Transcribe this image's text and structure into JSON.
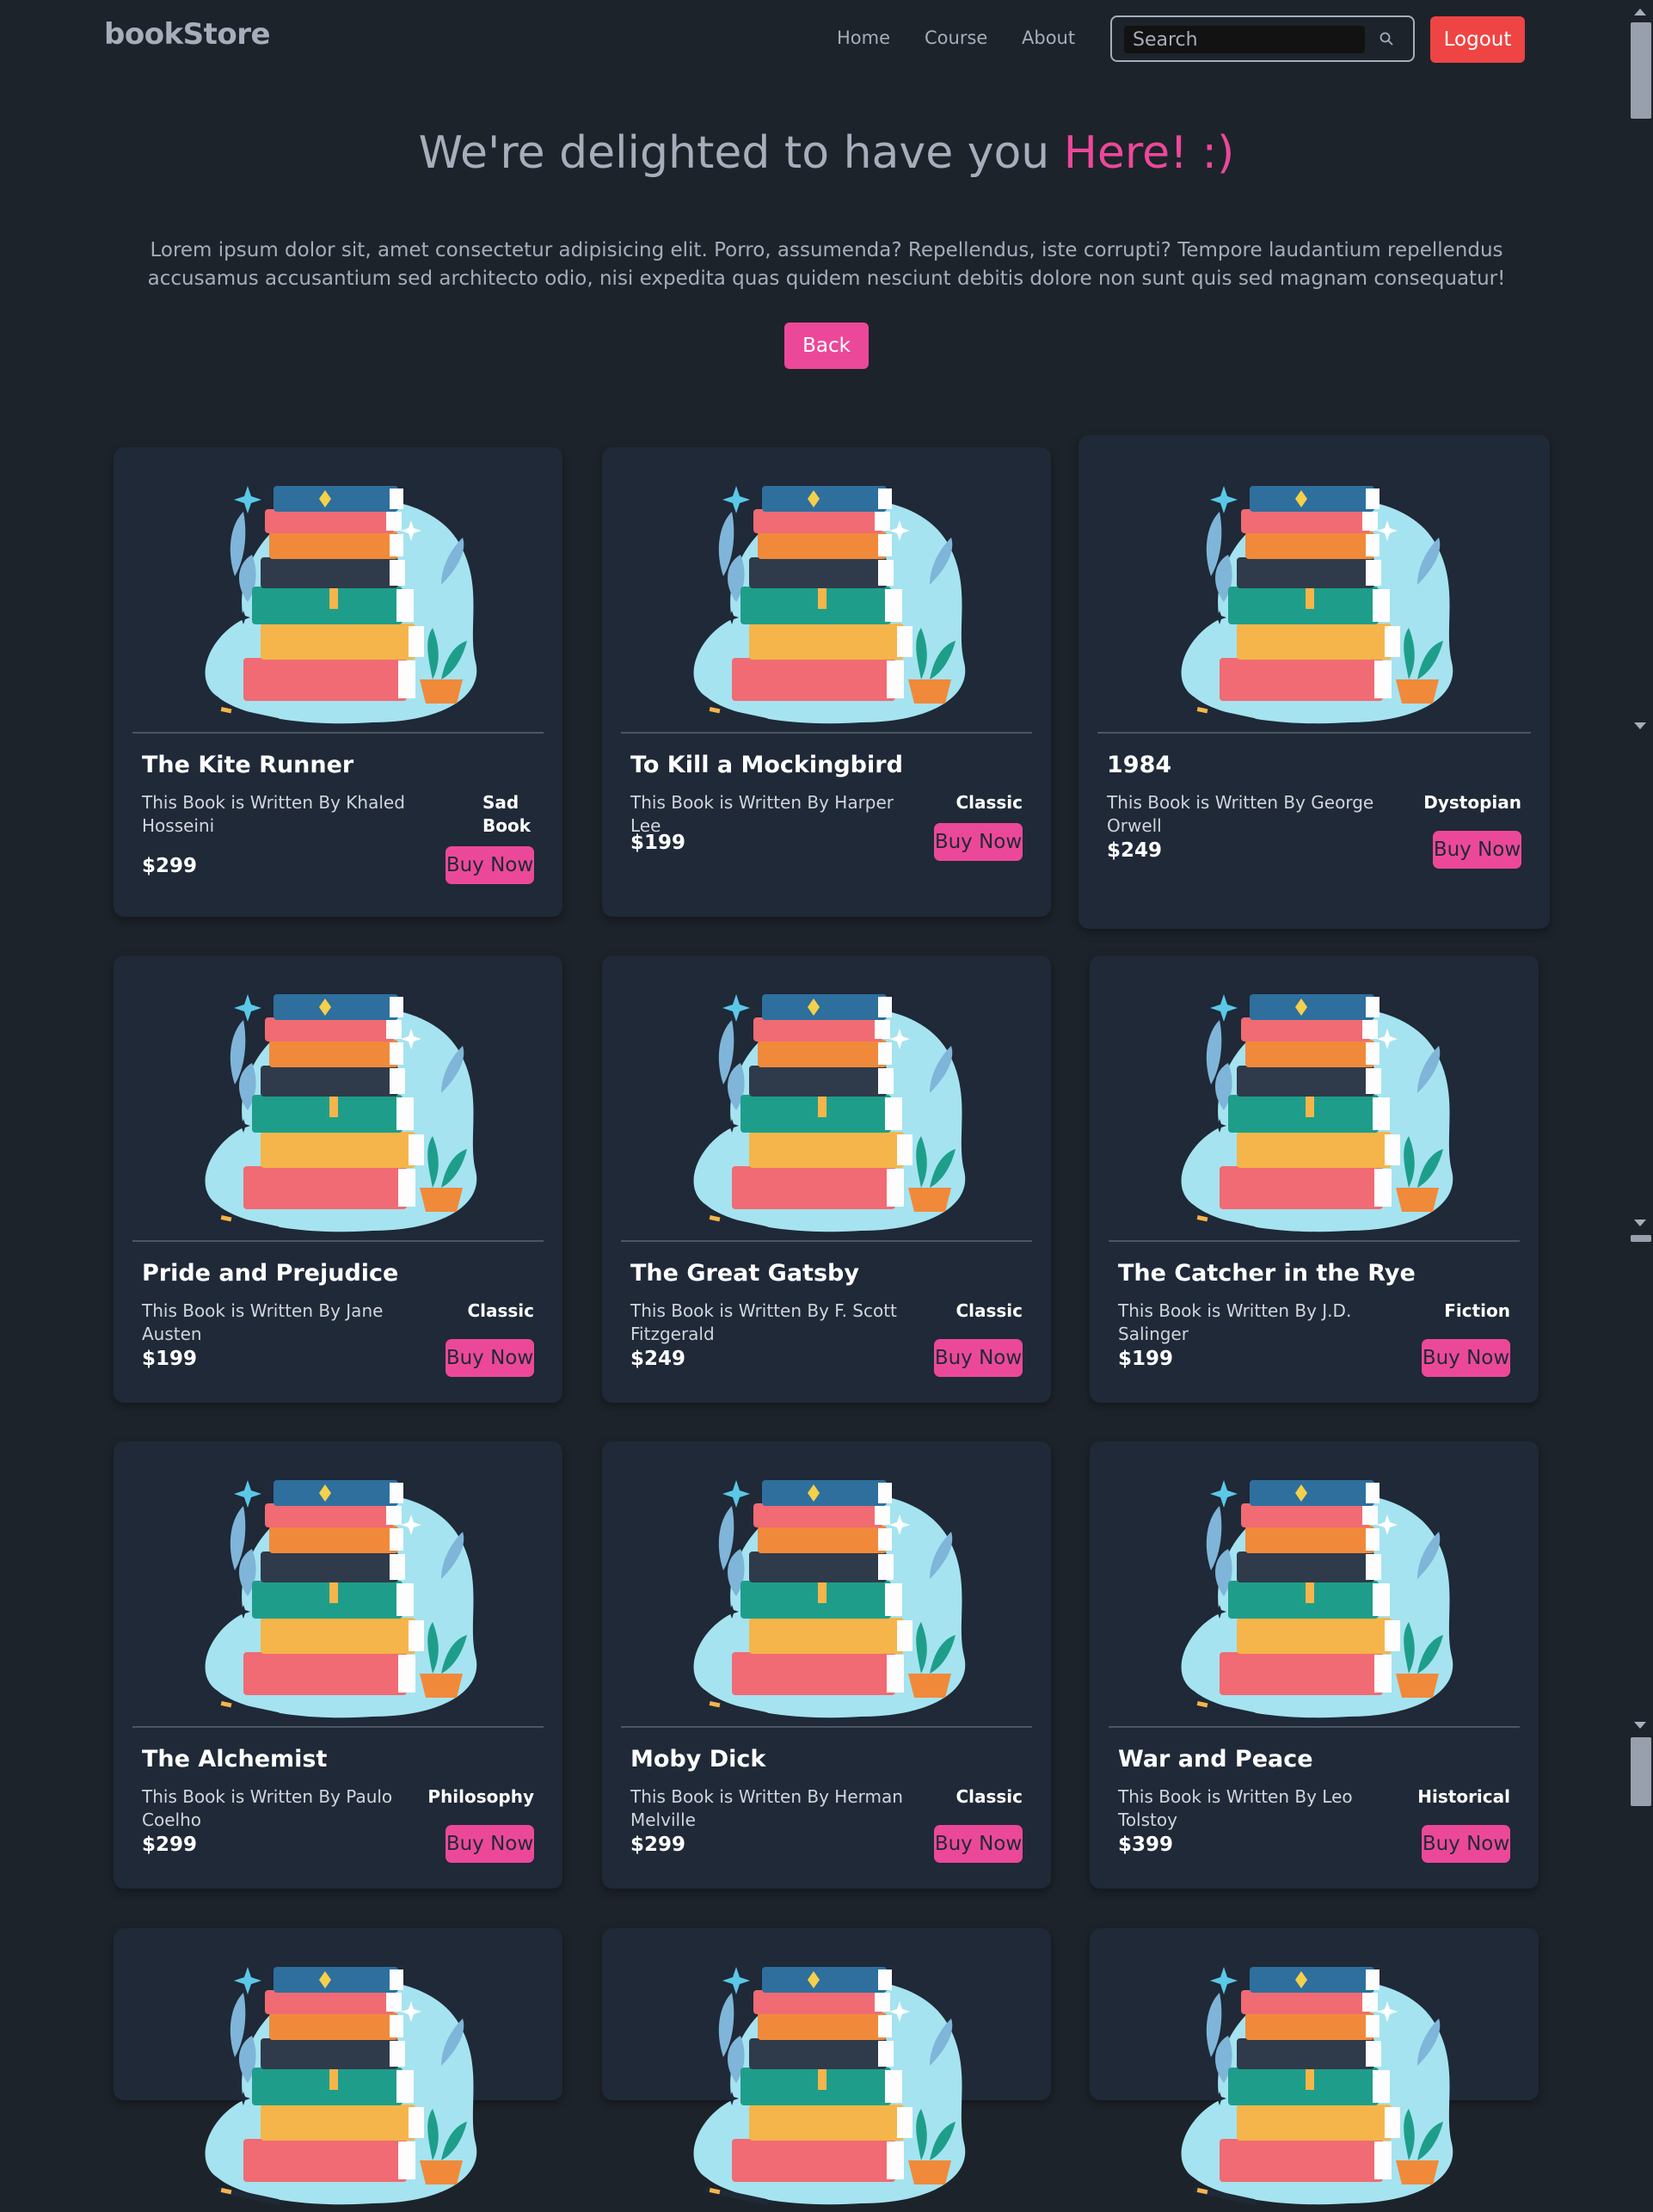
{
  "navbar": {
    "logo": "bookStore",
    "links": [
      "Home",
      "Course",
      "About"
    ],
    "search_placeholder": "Search",
    "logout_label": "Logout"
  },
  "hero": {
    "title_main": "We're delighted to have you ",
    "title_accent": "Here! :)",
    "text": "Lorem ipsum dolor sit, amet consectetur adipisicing elit. Porro, assumenda? Repellendus, iste corrupti? Tempore laudantium repellendus accusamus accusantium sed architecto odio, nisi expedita quas quidem nesciunt debitis dolore non sunt quis sed magnam consequatur!",
    "back_label": "Back"
  },
  "books": [
    {
      "title": "The Kite Runner",
      "author": "This Book is Written By Khaled Hosseini",
      "category": "Sad Book",
      "price": "$299",
      "buy_label": "Buy Now"
    },
    {
      "title": "To Kill a Mockingbird",
      "author": "This Book is Written By Harper Lee",
      "category": "Classic",
      "price": "$199",
      "buy_label": "Buy Now"
    },
    {
      "title": "1984",
      "author": "This Book is Written By George Orwell",
      "category": "Dystopian",
      "price": "$249",
      "buy_label": "Buy Now"
    },
    {
      "title": "Pride and Prejudice",
      "author": "This Book is Written By Jane Austen",
      "category": "Classic",
      "price": "$199",
      "buy_label": "Buy Now"
    },
    {
      "title": "The Great Gatsby",
      "author": "This Book is Written By F. Scott Fitzgerald",
      "category": "Classic",
      "price": "$249",
      "buy_label": "Buy Now"
    },
    {
      "title": "The Catcher in the Rye",
      "author": "This Book is Written By J.D. Salinger",
      "category": "Fiction",
      "price": "$199",
      "buy_label": "Buy Now"
    },
    {
      "title": "The Alchemist",
      "author": "This Book is Written By Paulo Coelho",
      "category": "Philosophy",
      "price": "$299",
      "buy_label": "Buy Now"
    },
    {
      "title": "Moby Dick",
      "author": "This Book is Written By Herman Melville",
      "category": "Classic",
      "price": "$299",
      "buy_label": "Buy Now"
    },
    {
      "title": "War and Peace",
      "author": "This Book is Written By Leo Tolstoy",
      "category": "Historical",
      "price": "$399",
      "buy_label": "Buy Now"
    }
  ],
  "colors": {
    "background": "#1d232a",
    "card": "#1f2937",
    "accent_pink": "#ec4899",
    "logout_red": "#ef4444"
  },
  "icons": {
    "search": "search-icon",
    "book_image": "book-stack-image"
  }
}
